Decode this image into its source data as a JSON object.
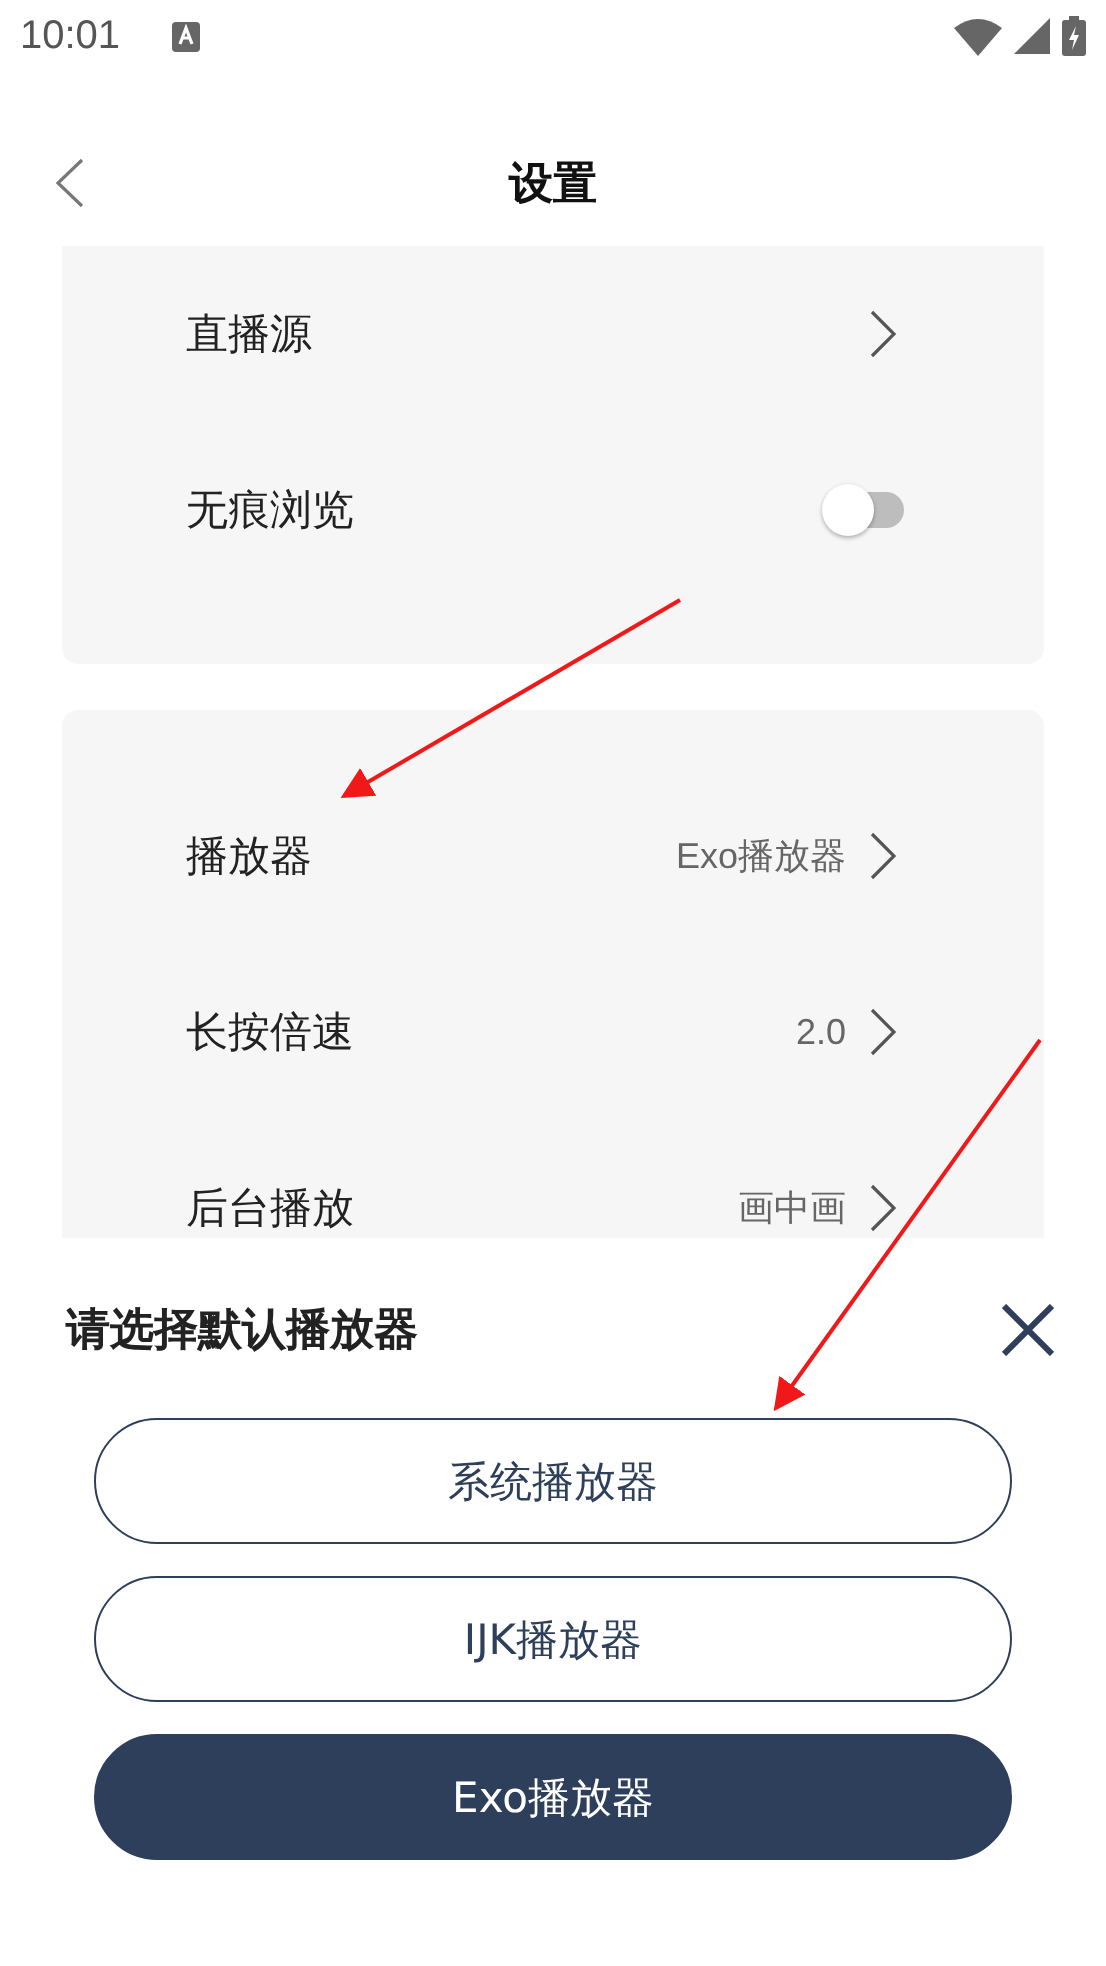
{
  "status_bar": {
    "time": "10:01"
  },
  "header": {
    "title": "设置"
  },
  "cards": [
    {
      "rows": [
        {
          "kind": "link",
          "label": "直播源"
        },
        {
          "kind": "toggle",
          "label": "无痕浏览",
          "on": false
        }
      ]
    },
    {
      "rows": [
        {
          "kind": "link",
          "label": "播放器",
          "value": "Exo播放器"
        },
        {
          "kind": "link",
          "label": "长按倍速",
          "value": "2.0"
        },
        {
          "kind": "link",
          "label": "后台播放",
          "value": "画中画"
        },
        {
          "kind": "hidden"
        },
        {
          "kind": "hidden"
        },
        {
          "kind": "hidden"
        }
      ]
    }
  ],
  "sheet": {
    "title": "请选择默认播放器",
    "options": [
      {
        "label": "系统播放器",
        "selected": false
      },
      {
        "label": "IJK播放器",
        "selected": false
      },
      {
        "label": "Exo播放器",
        "selected": true
      }
    ]
  }
}
